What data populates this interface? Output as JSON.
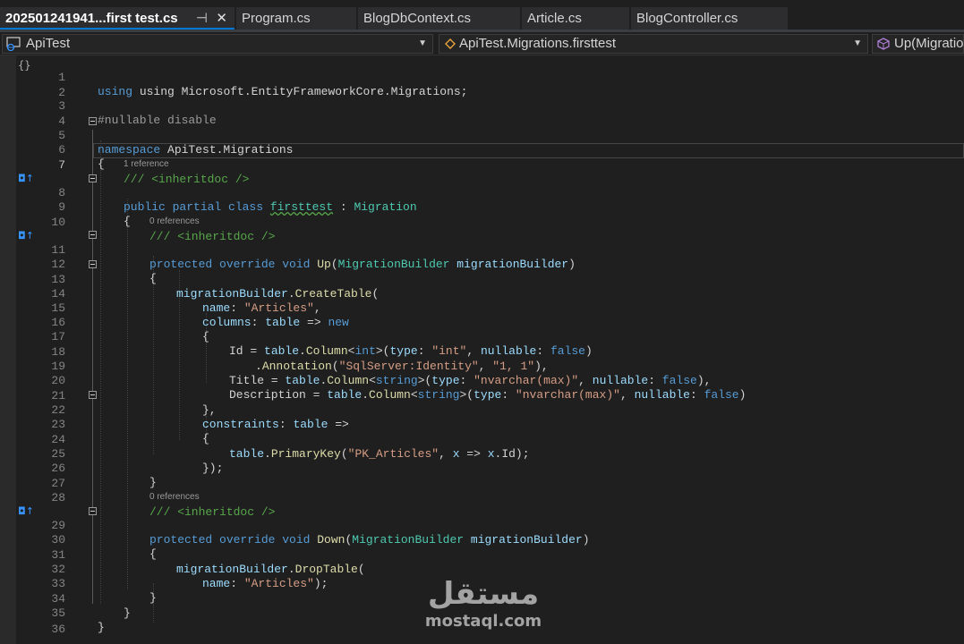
{
  "tabs": [
    {
      "label": "202501241941...first test.cs",
      "active": true
    },
    {
      "label": "Program.cs",
      "active": false
    },
    {
      "label": "BlogDbContext.cs",
      "active": false
    },
    {
      "label": "Article.cs",
      "active": false
    },
    {
      "label": "BlogController.cs",
      "active": false
    }
  ],
  "tab_icons": {
    "pin": "⊣",
    "close": "✕"
  },
  "navbar": {
    "project": "ApiTest",
    "type_scope": "ApiTest.Migrations.firsttest",
    "member_scope": "Up(Migratio"
  },
  "colors": {
    "keyword": "#569cd6",
    "type": "#4ec9b0",
    "string": "#d69d85",
    "comment": "#57a64a",
    "method": "#dcdcaa",
    "parameter": "#9cdcfe"
  },
  "code": {
    "l1": "using Microsoft.EntityFrameworkCore.Migrations;",
    "l3": "#nullable disable",
    "l5_kw": "namespace",
    "l5_name": " ApiTest.Migrations",
    "l6": "{",
    "l7": "/// <inheritdoc />",
    "lens7": "1 reference",
    "l8_kw": "public partial class ",
    "l8_name": "firsttest",
    "l8_sep": " : ",
    "l8_base": "Migration",
    "l9": "{",
    "l10": "/// <inheritdoc />",
    "lens10": "0 references",
    "l11_kw": "protected override void ",
    "l11_me": "Up",
    "l11_p1": "(",
    "l11_ty": "MigrationBuilder",
    "l11_pa": " migrationBuilder",
    "l11_p2": ")",
    "l12": "{",
    "l13_pa": "migrationBuilder",
    "l13_dot": ".",
    "l13_me": "CreateTable",
    "l13_p": "(",
    "l14_pa": "name",
    "l14_c": ": ",
    "l14_st": "\"Articles\"",
    "l14_e": ",",
    "l15_pa": "columns",
    "l15_c": ": ",
    "l15_pa2": "table",
    "l15_ar": " => ",
    "l15_kw": "new",
    "l16": "{",
    "l17_a": "Id = ",
    "l17_b": "table",
    "l17_c": ".",
    "l17_d": "Column",
    "l17_e": "<",
    "l17_f": "int",
    "l17_g": ">(",
    "l17_h": "type",
    "l17_i": ": ",
    "l17_j": "\"int\"",
    "l17_k": ", ",
    "l17_l": "nullable",
    "l17_m": ": ",
    "l17_n": "false",
    "l17_o": ")",
    "l18_a": ".",
    "l18_b": "Annotation",
    "l18_c": "(",
    "l18_d": "\"SqlServer:Identity\"",
    "l18_e": ", ",
    "l18_f": "\"1, 1\"",
    "l18_g": "),",
    "l19_a": "Title = ",
    "l19_b": "table",
    "l19_c": ".",
    "l19_d": "Column",
    "l19_e": "<",
    "l19_f": "string",
    "l19_g": ">(",
    "l19_h": "type",
    "l19_i": ": ",
    "l19_j": "\"nvarchar(max)\"",
    "l19_k": ", ",
    "l19_l": "nullable",
    "l19_m": ": ",
    "l19_n": "false",
    "l19_o": "),",
    "l20_a": "Description = ",
    "l20_b": "table",
    "l20_c": ".",
    "l20_d": "Column",
    "l20_e": "<",
    "l20_f": "string",
    "l20_g": ">(",
    "l20_h": "type",
    "l20_i": ": ",
    "l20_j": "\"nvarchar(max)\"",
    "l20_k": ", ",
    "l20_l": "nullable",
    "l20_m": ": ",
    "l20_n": "false",
    "l20_o": ")",
    "l21": "},",
    "l22_pa": "constraints",
    "l22_c": ": ",
    "l22_pa2": "table",
    "l22_ar": " =>",
    "l23": "{",
    "l24_a": "table",
    "l24_b": ".",
    "l24_c": "PrimaryKey",
    "l24_d": "(",
    "l24_e": "\"PK_Articles\"",
    "l24_f": ", ",
    "l24_g": "x",
    "l24_h": " => ",
    "l24_i": "x",
    "l24_j": ".Id);",
    "l25": "});",
    "l26": "}",
    "l28": "/// <inheritdoc />",
    "lens28": "0 references",
    "l29_kw": "protected override void ",
    "l29_me": "Down",
    "l29_p1": "(",
    "l29_ty": "MigrationBuilder",
    "l29_pa": " migrationBuilder",
    "l29_p2": ")",
    "l30": "{",
    "l31_pa": "migrationBuilder",
    "l31_dot": ".",
    "l31_me": "DropTable",
    "l31_p": "(",
    "l32_pa": "name",
    "l32_c": ": ",
    "l32_st": "\"Articles\"",
    "l32_e": ");",
    "l33": "}",
    "l34": "}",
    "l35": "}"
  },
  "line_numbers": [
    "1",
    "2",
    "3",
    "4",
    "5",
    "6",
    "7",
    "8",
    "9",
    "10",
    "11",
    "12",
    "13",
    "14",
    "15",
    "16",
    "17",
    "18",
    "19",
    "20",
    "21",
    "22",
    "23",
    "24",
    "25",
    "26",
    "27",
    "28",
    "29",
    "30",
    "31",
    "32",
    "33",
    "34",
    "35",
    "36"
  ],
  "watermark": {
    "arabic": "مستقل",
    "latin": "mostaql.com"
  }
}
